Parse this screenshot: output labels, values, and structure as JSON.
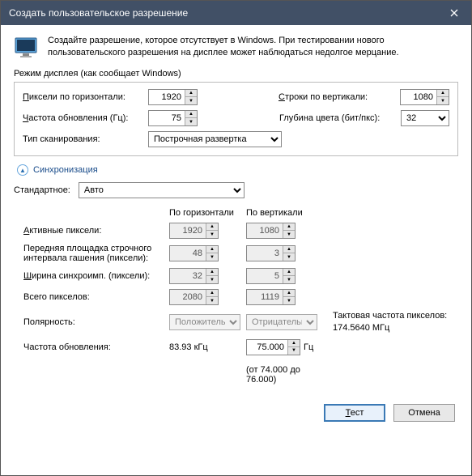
{
  "title": "Создать пользовательское разрешение",
  "intro": "Создайте разрешение, которое отсутствует в Windows. При тестировании нового пользовательского разрешения на дисплее может наблюдаться недолгое мерцание.",
  "display_mode": {
    "group_label": "Режим дисплея (как сообщает Windows)",
    "h_pixels_label": "Пиксели по горизонтали:",
    "h_pixels": "1920",
    "v_lines_label": "Строки по вертикали:",
    "v_lines": "1080",
    "refresh_label": "Частота обновления (Гц):",
    "refresh": "75",
    "color_depth_label": "Глубина цвета (бит/пкс):",
    "color_depth": "32",
    "scan_type_label": "Тип сканирования:",
    "scan_type": "Построчная развертка"
  },
  "sync": {
    "header": "Синхронизация",
    "standard_label": "Стандартное:",
    "standard": "Авто",
    "col_h": "По горизонтали",
    "col_v": "По вертикали",
    "active_label": "Активные пиксели:",
    "active_h": "1920",
    "active_v": "1080",
    "front_label": "Передняя площадка строчного интервала гашения (пиксели):",
    "front_h": "48",
    "front_v": "3",
    "syncwidth_label": "Ширина синхроимп. (пиксели):",
    "syncwidth_h": "32",
    "syncwidth_v": "5",
    "total_label": "Всего пикселов:",
    "total_h": "2080",
    "total_v": "1119",
    "polarity_label": "Полярность:",
    "polarity_h": "Положительная",
    "polarity_v": "Отрицательная",
    "pixelclock_label": "Тактовая частота пикселов:",
    "pixelclock_value": "174.5640 МГц",
    "refresh_label": "Частота обновления:",
    "refresh_h": "83.93 кГц",
    "refresh_v": "75.000",
    "refresh_unit": "Гц",
    "refresh_range": "(от 74.000 до 76.000)"
  },
  "buttons": {
    "test": "Тест",
    "cancel": "Отмена"
  }
}
